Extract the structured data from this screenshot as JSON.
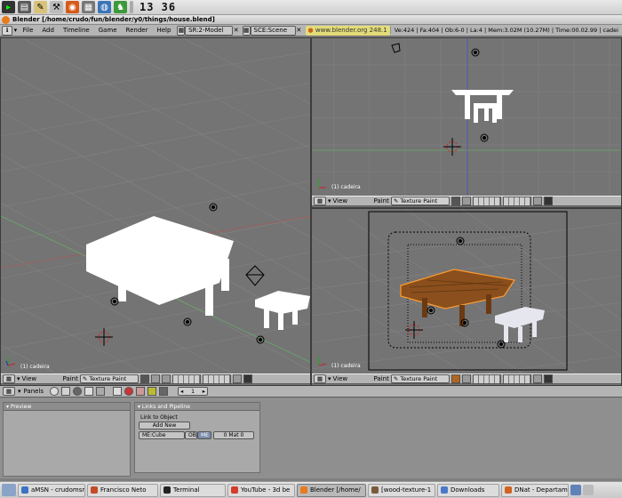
{
  "panel": {
    "clock": "13 36",
    "launchers": [
      "terminal-launcher-icon",
      "files-launcher-icon",
      "editor-launcher-icon",
      "tools-launcher-icon",
      "firefox-launcher-icon",
      "calculator-launcher-icon",
      "globe-launcher-icon",
      "game-launcher-icon"
    ]
  },
  "window": {
    "title": "Blender [/home/crudo/fun/blender/y0/things/house.blend]"
  },
  "info_header": {
    "menus": [
      "File",
      "Add",
      "Timeline",
      "Game",
      "Render",
      "Help"
    ],
    "screen": "SR:2-Model",
    "scene": "SCE:Scene",
    "url": "www.blender.org 248.1",
    "stats": [
      "Ve:424 | Fa:404 | Ob:6-0 | La:4 | Mem:3.02M (10.27M) | Time:00.02.99 | cadei"
    ]
  },
  "viewports": {
    "left": {
      "object_label": "(1) cadeira",
      "view_menu": "View",
      "mode": "Paint",
      "shading": "Texture Paint"
    },
    "top_right": {
      "object_label": "(1) cadeira",
      "view_menu": "View",
      "mode": "Paint",
      "shading": "Texture Paint"
    },
    "bottom_right": {
      "object_label": "(1) cadeira",
      "view_menu": "View",
      "mode": "Paint",
      "shading": "Texture Paint"
    }
  },
  "buttons": {
    "header_label": "Panels",
    "frame": "1",
    "preview_title": "Preview",
    "links_title": "Links and Pipeline",
    "link_to_object": "Link to Object",
    "add_new": "Add New",
    "me_field": "ME:Cube",
    "ob_btn": "OB",
    "me_btn": "ME",
    "mat_field": "0 Mat 0"
  },
  "taskbar": {
    "items": [
      {
        "label": "aMSN - crudomsn",
        "color": "#3a72c4"
      },
      {
        "label": "Francisco Neto",
        "color": "#c44a2a"
      },
      {
        "label": "Terminal",
        "color": "#222222"
      },
      {
        "label": "YouTube - 3d be",
        "color": "#d43b2b"
      },
      {
        "label": "Blender [/home/",
        "color": "#e87a1e"
      },
      {
        "label": "[wood-texture-1",
        "color": "#7a5a3a"
      },
      {
        "label": "Downloads",
        "color": "#4b79c9"
      },
      {
        "label": "DNat - Departam",
        "color": "#d1621f"
      }
    ]
  },
  "colors": {
    "accent_wood": "#8a4f1c",
    "selection": "#ff9a30"
  }
}
